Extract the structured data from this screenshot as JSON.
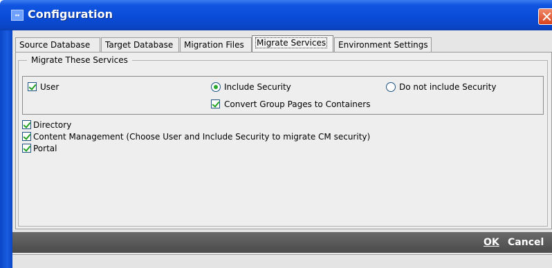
{
  "window": {
    "title": "Configuration",
    "app_icon": "app-icon"
  },
  "tabs": [
    {
      "label": "Source Database",
      "active": false
    },
    {
      "label": "Target Database",
      "active": false
    },
    {
      "label": "Migration Files",
      "active": false
    },
    {
      "label": "Migrate Services",
      "active": true
    },
    {
      "label": "Environment Settings",
      "active": false
    }
  ],
  "group": {
    "legend": "Migrate These Services",
    "user": {
      "label": "User",
      "checked": true
    },
    "include_security": {
      "label": "Include Security",
      "selected": true
    },
    "no_security": {
      "label": "Do not include Security",
      "selected": false
    },
    "convert_group_pages": {
      "label": "Convert Group Pages to Containers",
      "checked": true
    },
    "services": [
      {
        "label": "Directory",
        "checked": true
      },
      {
        "label": "Content Management (Choose User and Include Security to migrate CM security)",
        "checked": true
      },
      {
        "label": "Portal",
        "checked": true
      }
    ]
  },
  "buttons": {
    "ok": "OK",
    "cancel": "Cancel"
  }
}
